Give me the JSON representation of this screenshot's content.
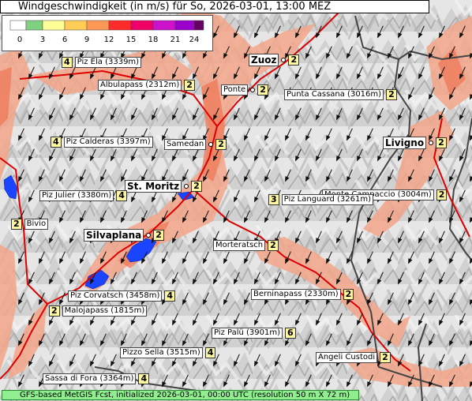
{
  "title": "Windgeschwindigkeit (in m/s) für So, 2026-03-01, 13:00 MEZ",
  "legend": {
    "ticks": [
      "0",
      "3",
      "6",
      "9",
      "12",
      "15",
      "18",
      "21",
      "24"
    ],
    "colors": [
      "#ffffff",
      "#7fd07f",
      "#ffff99",
      "#ffcc55",
      "#ff9955",
      "#ff2b2b",
      "#ee0066",
      "#cc11cc",
      "#9900cc",
      "#660066"
    ]
  },
  "footer": "GFS-based MetGIS Fcst, initialized 2026-03-01, 00:00 UTC  (resolution 50 m X 72 m)",
  "places": [
    {
      "name": "Piz Ela (3339m)",
      "value": "4",
      "big": false,
      "marker": false
    },
    {
      "name": "Zuoz",
      "value": "2",
      "big": true,
      "marker": true
    },
    {
      "name": "Albulapass (2312m)",
      "value": "2",
      "big": false,
      "marker": false
    },
    {
      "name": "Ponte",
      "value": "2",
      "big": false,
      "marker": true
    },
    {
      "name": "Punta Cassana (3016m)",
      "value": "2",
      "big": false,
      "marker": false
    },
    {
      "name": "Piz Calderas (3397m)",
      "value": "4",
      "big": false,
      "marker": false
    },
    {
      "name": "Samedan",
      "value": "2",
      "big": false,
      "marker": true
    },
    {
      "name": "Livigno",
      "value": "2",
      "big": true,
      "marker": true
    },
    {
      "name": "St. Moritz",
      "value": "2",
      "big": true,
      "marker": true
    },
    {
      "name": "Monte Campaccio (3004m)",
      "value": "2",
      "big": false,
      "marker": false
    },
    {
      "name": "Piz Julier (3380m)",
      "value": "4",
      "big": false,
      "marker": false
    },
    {
      "name": "Piz Languard (3261m)",
      "value": "3",
      "big": false,
      "marker": false
    },
    {
      "name": "Bivio",
      "value": "2",
      "big": false,
      "marker": false
    },
    {
      "name": "Silvaplana",
      "value": "2",
      "big": true,
      "marker": true
    },
    {
      "name": "Morteratsch",
      "value": "2",
      "big": false,
      "marker": false
    },
    {
      "name": "Piz Corvatsch (3458m)",
      "value": "4",
      "big": false,
      "marker": false
    },
    {
      "name": "Berninapass (2330m)",
      "value": "2",
      "big": false,
      "marker": false
    },
    {
      "name": "Malojapass (1815m)",
      "value": "2",
      "big": false,
      "marker": false
    },
    {
      "name": "Piz Palü (3901m)",
      "value": "6",
      "big": false,
      "marker": false
    },
    {
      "name": "Pizzo Sella (3515m)",
      "value": "4",
      "big": false,
      "marker": false
    },
    {
      "name": "Angeli Custodi",
      "value": "2",
      "big": false,
      "marker": false
    },
    {
      "name": "Sassa di Fora (3364m)",
      "value": "4",
      "big": false,
      "marker": false
    }
  ]
}
